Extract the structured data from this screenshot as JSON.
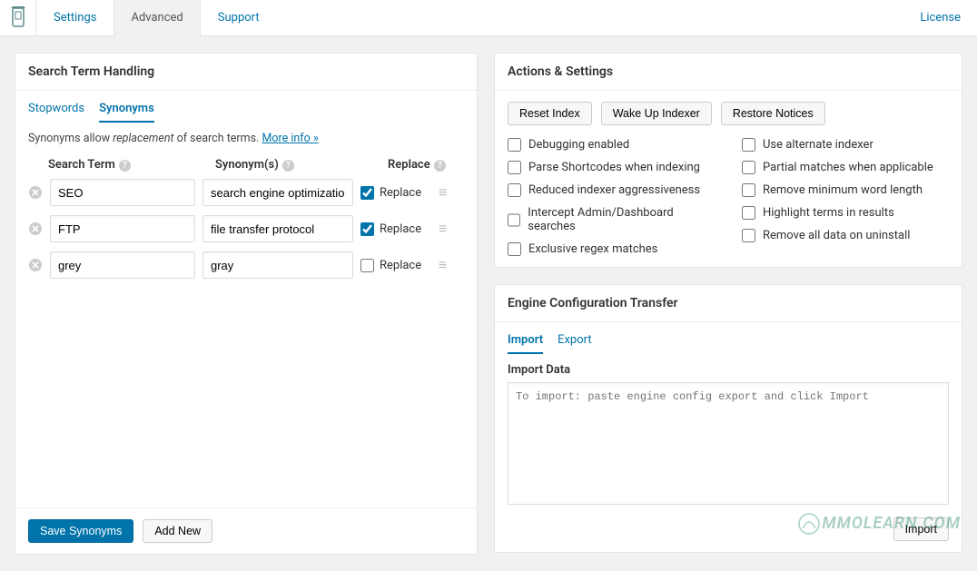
{
  "nav": {
    "tabs": [
      "Settings",
      "Advanced",
      "Support"
    ],
    "active_index": 1,
    "license": "License"
  },
  "search_panel": {
    "title": "Search Term Handling",
    "subtabs": [
      "Stopwords",
      "Synonyms"
    ],
    "active_subtab": 1,
    "description_prefix": "Synonyms allow ",
    "description_em": "replacement",
    "description_suffix": " of search terms. ",
    "more_info": "More info »",
    "headers": {
      "term": "Search Term",
      "syn": "Synonym(s)",
      "replace": "Replace"
    },
    "rows": [
      {
        "term": "SEO",
        "syn": "search engine optimization",
        "replace": true
      },
      {
        "term": "FTP",
        "syn": "file transfer protocol",
        "replace": true
      },
      {
        "term": "grey",
        "syn": "gray",
        "replace": false
      }
    ],
    "replace_label": "Replace",
    "save_btn": "Save Synonyms",
    "add_btn": "Add New"
  },
  "actions_panel": {
    "title": "Actions & Settings",
    "buttons": [
      "Reset Index",
      "Wake Up Indexer",
      "Restore Notices"
    ],
    "checks_left": [
      "Debugging enabled",
      "Parse Shortcodes when indexing",
      "Reduced indexer aggressiveness",
      "Intercept Admin/Dashboard searches",
      "Exclusive regex matches"
    ],
    "checks_right": [
      "Use alternate indexer",
      "Partial matches when applicable",
      "Remove minimum word length",
      "Highlight terms in results",
      "Remove all data on uninstall"
    ]
  },
  "engine_panel": {
    "title": "Engine Configuration Transfer",
    "subtabs": [
      "Import",
      "Export"
    ],
    "active_subtab": 0,
    "import_label": "Import Data",
    "import_placeholder": "To import: paste engine config export and click Import",
    "import_btn": "Import"
  },
  "watermark": "MMOLEARN.COM"
}
